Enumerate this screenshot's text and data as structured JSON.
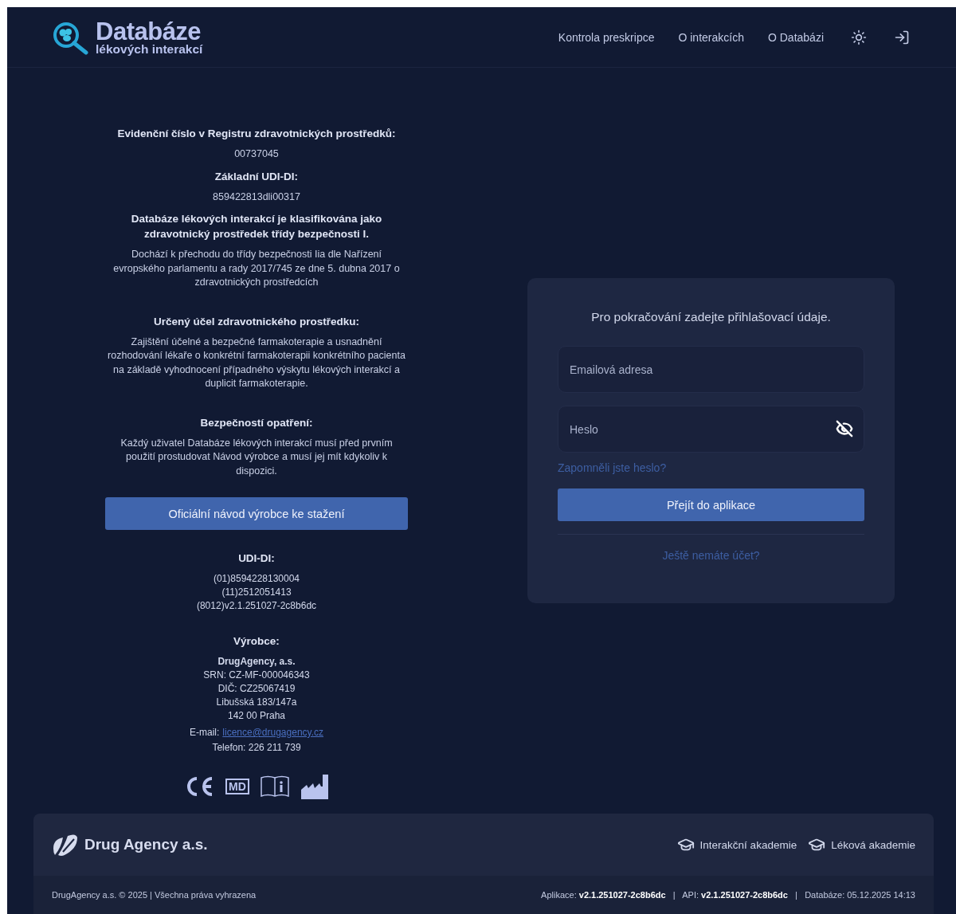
{
  "header": {
    "logo": {
      "title": "Databáze",
      "subtitle": "lékových interakcí"
    },
    "nav": [
      {
        "label": "Kontrola preskripce"
      },
      {
        "label": "O interakcích"
      },
      {
        "label": "O Databázi"
      }
    ]
  },
  "registry": [
    {
      "heading": "Evidenční číslo v Registru zdravotnických prostředků:",
      "text": "00737045"
    },
    {
      "heading": "Základní UDI-DI:",
      "text": "859422813dli00317"
    },
    {
      "heading": "Databáze lékových interakcí je klasifikována jako zdravotnický prostředek třídy bezpečnosti I.",
      "text": "Dochází k přechodu do třídy bezpečnosti Iia dle Nařízení evropského parlamentu a rady 2017/745 ze dne 5. dubna 2017 o zdravotnických prostředcích"
    }
  ],
  "purpose": [
    {
      "heading": "Určený účel zdravotnického prostředku:",
      "text": "Zajištění účelné a bezpečné farmakoterapie a usnadnění rozhodování lékaře o konkrétní farmakoterapii konkrétního pacienta na základě vyhodnocení případného výskytu lékových interakcí a duplicit farmakoterapie."
    },
    {
      "heading": "Bezpečností opatření:",
      "text": "Každý uživatel Databáze lékových interakcí musí před prvním použití prostudovat Návod výrobce a musí jej mít kdykoliv k dispozici."
    }
  ],
  "manual_button": "Oficiální návod výrobce ke stažení",
  "udi": {
    "heading": "UDI-DI:",
    "lines": [
      "(01)8594228130004",
      "(11)2512051413",
      "(8012)v2.1.251027-2c8b6dc"
    ]
  },
  "manufacturer": {
    "heading": "Výrobce:",
    "name": "DrugAgency, a.s.",
    "lines": [
      "SRN: CZ-MF-000046343",
      "DIČ: CZ25067419",
      "Libušská 183/147a",
      "142 00 Praha"
    ],
    "email_label": "E-mail:",
    "email": "licence@drugagency.cz",
    "phone": "Telefon: 226 211 739"
  },
  "md_symbol": "MD",
  "login": {
    "prompt": "Pro pokračování zadejte přihlašovací údaje.",
    "email_placeholder": "Emailová adresa",
    "password_placeholder": "Heslo",
    "forgot_link": "Zapomněli jste heslo?",
    "submit": "Přejít do aplikace",
    "register_link": "Ještě nemáte účet?"
  },
  "footer": {
    "brand": "Drug Agency a.s.",
    "links": [
      {
        "label": "Interakční akademie"
      },
      {
        "label": "Léková akademie"
      }
    ],
    "copyright": "DrugAgency a.s. © 2025 | Všechna práva vyhrazena",
    "versions": "Aplikace: **v2.1.251027-2c8b6dc**   |   API: **v2.1.251027-2c8b6dc**   |   Databáze: 05.12.2025 14:13"
  }
}
